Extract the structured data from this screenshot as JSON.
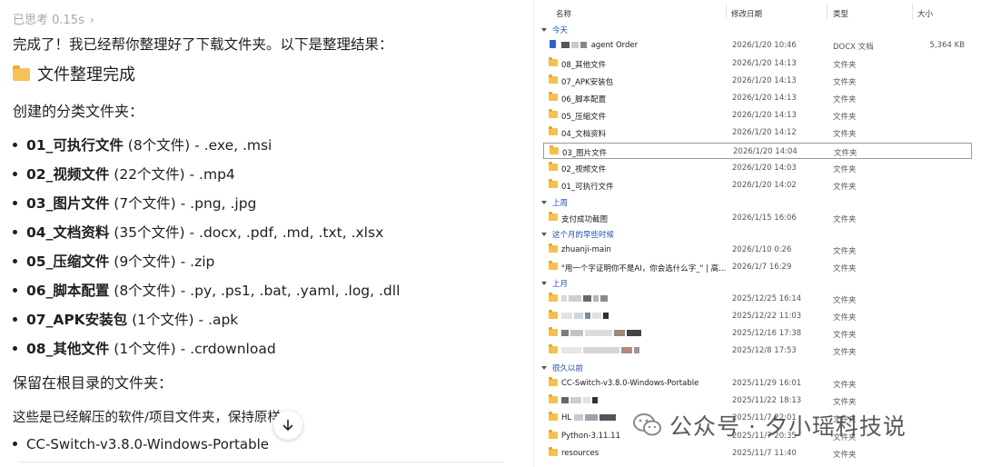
{
  "chat": {
    "thinking_label": "已思考 0.15s",
    "intro": "完成了！我已经帮你整理好了下载文件夹。以下是整理结果：",
    "heading": "文件整理完成",
    "created_label": "创建的分类文件夹：",
    "folders": [
      {
        "name": "01_可执行文件",
        "count": "(8个文件)",
        "ext": " - .exe, .msi"
      },
      {
        "name": "02_视频文件",
        "count": "(22个文件)",
        "ext": " - .mp4"
      },
      {
        "name": "03_图片文件",
        "count": "(7个文件)",
        "ext": " - .png, .jpg"
      },
      {
        "name": "04_文档资料",
        "count": "(35个文件)",
        "ext": " - .docx, .pdf, .md, .txt, .xlsx"
      },
      {
        "name": "05_压缩文件",
        "count": "(9个文件)",
        "ext": " - .zip"
      },
      {
        "name": "06_脚本配置",
        "count": "(8个文件)",
        "ext": " - .py, .ps1, .bat, .yaml, .log, .dll"
      },
      {
        "name": "07_APK安装包",
        "count": "(1个文件)",
        "ext": " - .apk"
      },
      {
        "name": "08_其他文件",
        "count": "(1个文件)",
        "ext": " - .crdownload"
      }
    ],
    "keep_label": "保留在根目录的文件夹：",
    "keep_desc": "这些是已经解压的软件/项目文件夹，保持原样",
    "keep_items": [
      "CC-Switch-v3.8.0-Windows-Portable"
    ]
  },
  "explorer": {
    "columns": {
      "name": "名称",
      "date": "修改日期",
      "type": "类型",
      "size": "大小"
    },
    "groups": {
      "today": "今天",
      "last_week": "上周",
      "earlier_month": "这个月的早些时候",
      "last_month": "上月",
      "long_ago": "很久以前"
    },
    "today_rows": [
      {
        "name": "agent Order",
        "date": "2026/1/20 10:46",
        "type": "DOCX 文档",
        "size": "5,364 KB",
        "icon": "docx-icon"
      },
      {
        "name": "08_其他文件",
        "date": "2026/1/20 14:13",
        "type": "文件夹",
        "size": ""
      },
      {
        "name": "07_APK安装包",
        "date": "2026/1/20 14:13",
        "type": "文件夹",
        "size": ""
      },
      {
        "name": "06_脚本配置",
        "date": "2026/1/20 14:13",
        "type": "文件夹",
        "size": ""
      },
      {
        "name": "05_压缩文件",
        "date": "2026/1/20 14:13",
        "type": "文件夹",
        "size": ""
      },
      {
        "name": "04_文档资料",
        "date": "2026/1/20 14:12",
        "type": "文件夹",
        "size": ""
      },
      {
        "name": "03_图片文件",
        "date": "2026/1/20 14:04",
        "type": "文件夹",
        "size": ""
      },
      {
        "name": "02_视频文件",
        "date": "2026/1/20 14:03",
        "type": "文件夹",
        "size": ""
      },
      {
        "name": "01_可执行文件",
        "date": "2026/1/20 14:02",
        "type": "文件夹",
        "size": ""
      }
    ],
    "last_week_rows": [
      {
        "name": "支付成功截图",
        "date": "2026/1/15 16:06",
        "type": "文件夹"
      }
    ],
    "earlier_month_rows": [
      {
        "name": "zhuanji-main",
        "date": "2026/1/10 0:26",
        "type": "文件夹"
      },
      {
        "name": "\"用一个字证明你不是AI，你会选什么字_\" | 高...",
        "date": "2026/1/7 16:29",
        "type": "文件夹"
      }
    ],
    "last_month_rows": [
      {
        "name": "",
        "date": "2025/12/25 16:14",
        "type": "文件夹"
      },
      {
        "name": "",
        "date": "2025/12/22 11:03",
        "type": "文件夹"
      },
      {
        "name": "",
        "date": "2025/12/16 17:38",
        "type": "文件夹"
      },
      {
        "name": "",
        "date": "2025/12/8 17:53",
        "type": "文件夹"
      }
    ],
    "long_ago_rows": [
      {
        "name": "CC-Switch-v3.8.0-Windows-Portable",
        "date": "2025/11/29 16:01",
        "type": "文件夹"
      },
      {
        "name": "",
        "date": "2025/11/22 18:13",
        "type": "文件夹"
      },
      {
        "name": "HL",
        "date": "2025/11/7 22:01",
        "type": "文件夹"
      },
      {
        "name": "Python-3.11.11",
        "date": "2025/11/7 20:35",
        "type": "文件夹"
      },
      {
        "name": "resources",
        "date": "2025/11/7 11:40",
        "type": "文件夹"
      }
    ]
  },
  "watermark": {
    "text": "公众号 · 夕小瑶科技说"
  }
}
